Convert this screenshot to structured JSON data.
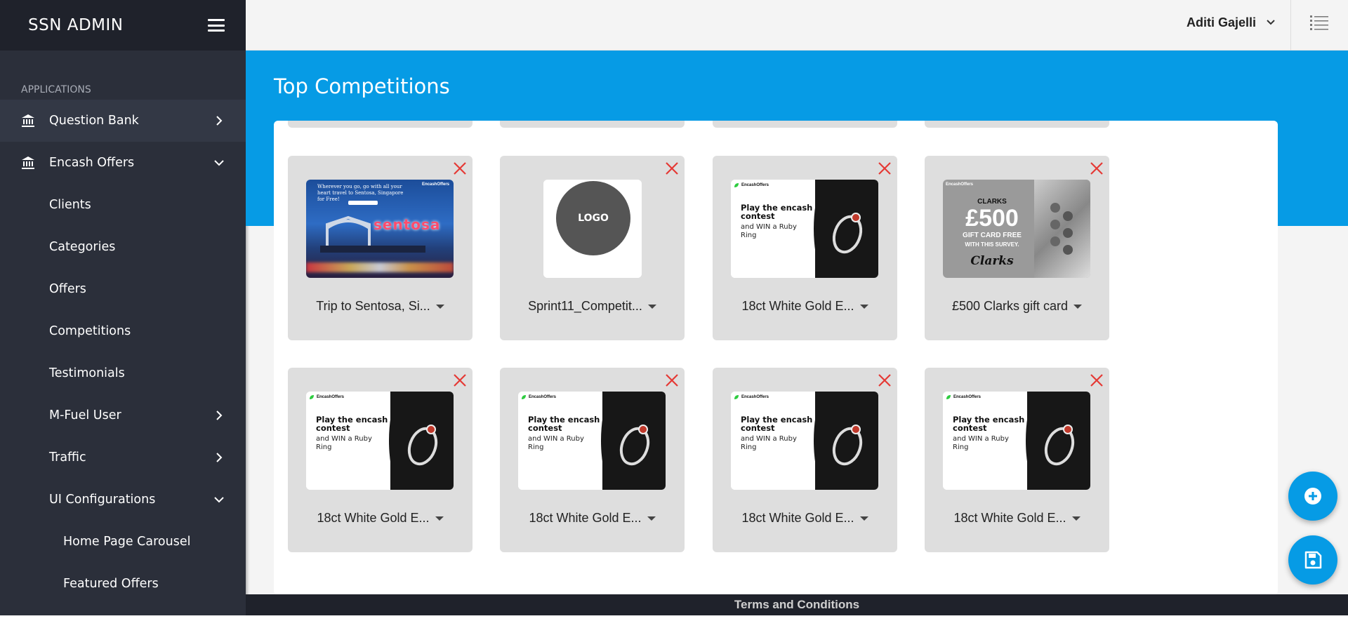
{
  "sidebar": {
    "brand": "SSN ADMIN",
    "section": "APPLICATIONS",
    "items": [
      {
        "label": "Question Bank"
      },
      {
        "label": "Encash Offers"
      },
      {
        "label": "Clients"
      },
      {
        "label": "Categories"
      },
      {
        "label": "Offers"
      },
      {
        "label": "Competitions"
      },
      {
        "label": "Testimonials"
      },
      {
        "label": "M-Fuel User"
      },
      {
        "label": "Traffic"
      },
      {
        "label": "UI Configurations"
      },
      {
        "label": "Home Page Carousel"
      },
      {
        "label": "Featured Offers"
      }
    ]
  },
  "topbar": {
    "user_name": "Aditi Gajelli"
  },
  "page": {
    "title": "Top Competitions"
  },
  "thumbs": {
    "ring_brand": "EncashOffers",
    "ring_headline": "Play the encash contest",
    "ring_sub": "and WIN a Ruby Ring",
    "logo_text": "LOGO",
    "sentosa_caption": "Wherever you go, go with all your heart travel to Sentosa, Singapore for Free!",
    "sentosa_word": "sentosa",
    "clarks_line1": "CLARKS",
    "clarks_line2": "£500",
    "clarks_line3": "GIFT CARD FREE",
    "clarks_line4": "WITH THIS SURVEY.",
    "clarks_line5": "Clarks"
  },
  "cards": [
    {
      "title": "Trip to Sentosa, Si..."
    },
    {
      "title": "Sprint11_Competit..."
    },
    {
      "title": "18ct White Gold E..."
    },
    {
      "title": "£500 Clarks gift card"
    },
    {
      "title": "18ct White Gold E..."
    },
    {
      "title": "18ct White Gold E..."
    },
    {
      "title": "18ct White Gold E..."
    },
    {
      "title": "18ct White Gold E..."
    }
  ],
  "footer": {
    "text": "Terms and Conditions"
  },
  "colors": {
    "accent": "#069be5",
    "sidebar": "#2b2f3a",
    "close": "#e53935"
  }
}
